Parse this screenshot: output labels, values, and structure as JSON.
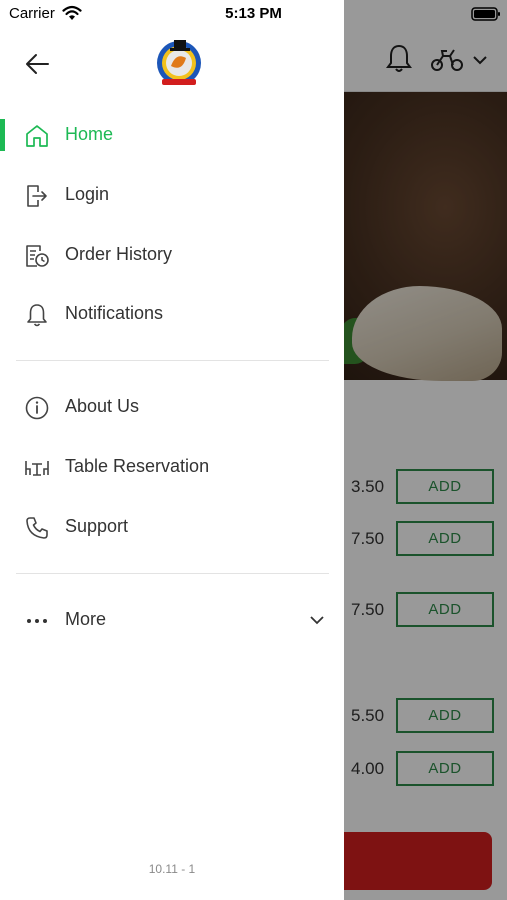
{
  "status_bar": {
    "carrier": "Carrier",
    "time": "5:13 PM"
  },
  "drawer": {
    "menu": [
      {
        "label": "Home",
        "icon": "home-icon",
        "active": true
      },
      {
        "label": "Login",
        "icon": "login-icon"
      },
      {
        "label": "Order History",
        "icon": "order-history-icon"
      },
      {
        "label": "Notifications",
        "icon": "bell-icon"
      },
      {
        "label": "About Us",
        "icon": "info-icon"
      },
      {
        "label": "Table Reservation",
        "icon": "table-reservation-icon"
      },
      {
        "label": "Support",
        "icon": "phone-icon"
      },
      {
        "label": "More",
        "icon": "more-dots-icon"
      }
    ],
    "version": "10.11 - 1"
  },
  "background": {
    "items": [
      {
        "price": "3.50",
        "add_label": "ADD"
      },
      {
        "price": "7.50",
        "add_label": "ADD"
      },
      {
        "price": "7.50",
        "add_label": "ADD"
      },
      {
        "price": "5.50",
        "add_label": "ADD"
      },
      {
        "price": "4.00",
        "add_label": "ADD"
      }
    ]
  },
  "colors": {
    "accent": "#1db954",
    "add_button": "#2e8a4a",
    "cart_button": "#d21e1e",
    "text": "#333333"
  }
}
